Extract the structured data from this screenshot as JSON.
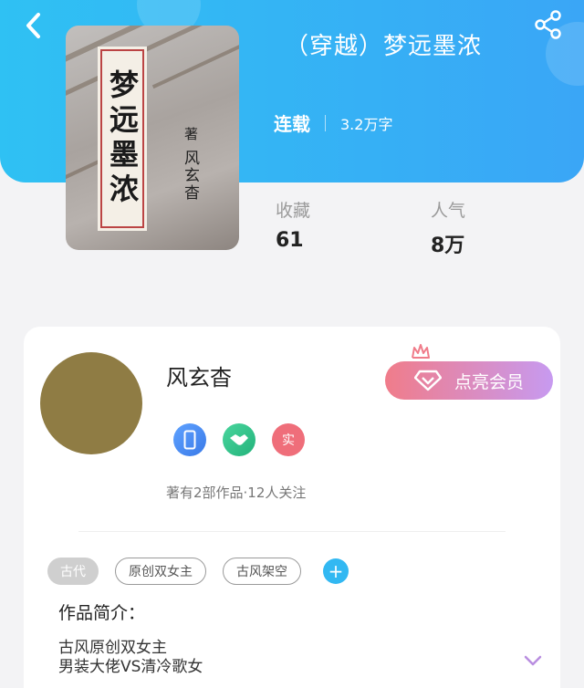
{
  "header": {
    "title": "（穿越）梦远墨浓",
    "status_label": "连载",
    "word_count": "3.2万字",
    "back_icon": "chevron-left-icon",
    "share_icon": "share-icon",
    "background_color": "#2fc1f3"
  },
  "cover": {
    "title_text": "梦远墨浓",
    "author_mark": "著",
    "author_text": "风玄杳"
  },
  "stats": [
    {
      "label": "收藏",
      "value": "61"
    },
    {
      "label": "人气",
      "value": "8万"
    }
  ],
  "author": {
    "name": "风玄杳",
    "meta": "著有2部作品·12人关注",
    "avatar_color": "#8f7c44",
    "badges": [
      {
        "icon": "phone-badge-icon",
        "text": ""
      },
      {
        "icon": "handshake-badge-icon",
        "text": ""
      },
      {
        "icon": "real-name-badge-icon",
        "text": "实"
      }
    ],
    "vip_button_label": "点亮会员"
  },
  "tags": [
    {
      "label": "古代",
      "style": "filled"
    },
    {
      "label": "原创双女主",
      "style": "outline"
    },
    {
      "label": "古风架空",
      "style": "outline"
    }
  ],
  "tag_add_label": "+",
  "intro": {
    "title": "作品简介：",
    "lines": [
      "古风原创双女主",
      "男装大佬VS清冷歌女"
    ]
  }
}
